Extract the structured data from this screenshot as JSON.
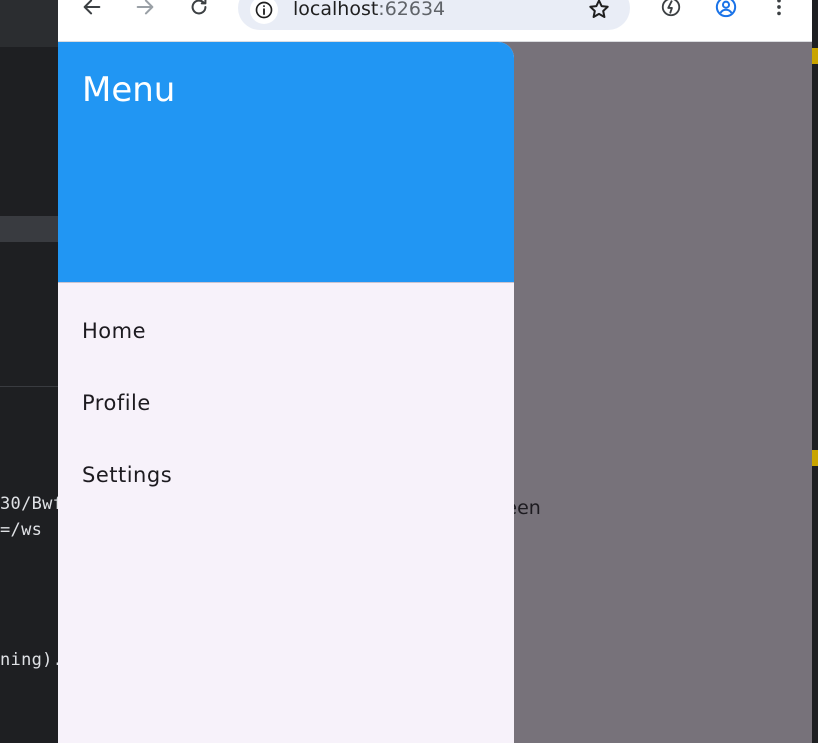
{
  "ide": {
    "code_lines": [
      "30/Bwf",
      "=/ws",
      "ning)."
    ]
  },
  "browser": {
    "url_host": "localhost",
    "url_port": ":62634"
  },
  "page": {
    "background_text": "reen"
  },
  "drawer": {
    "title": "Menu",
    "items": [
      {
        "label": "Home"
      },
      {
        "label": "Profile"
      },
      {
        "label": "Settings"
      }
    ]
  },
  "colors": {
    "header": "#2196f3",
    "drawer_bg": "#f7f2fa",
    "scrim": "#77727a"
  }
}
